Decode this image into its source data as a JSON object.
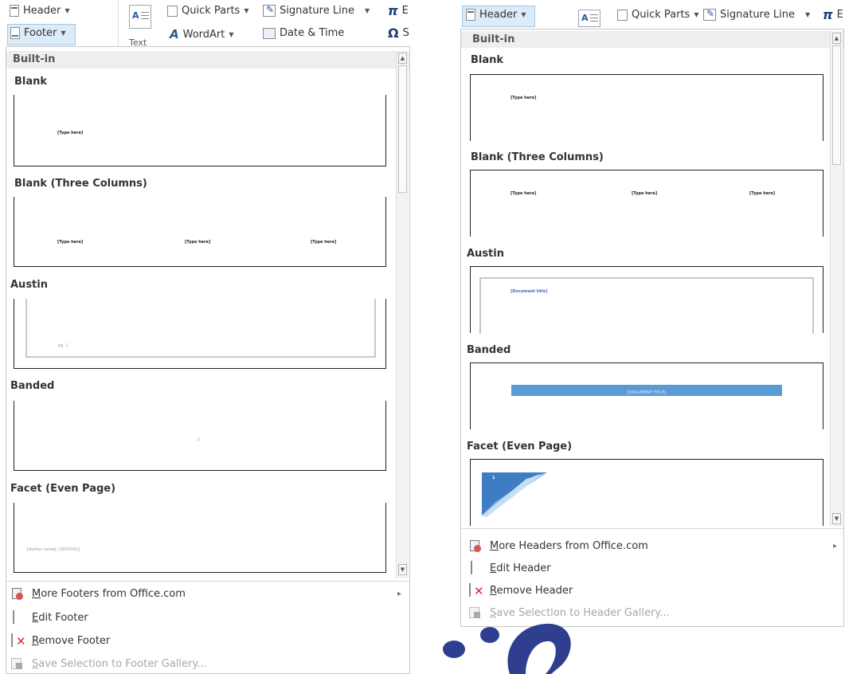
{
  "left": {
    "ribbon": {
      "header": "Header",
      "footer": "Footer",
      "text": "Text",
      "quick_parts": "Quick Parts",
      "wordart": "WordArt",
      "signature_line": "Signature Line",
      "date_time": "Date & Time",
      "pi": "π",
      "pi_partial": "E",
      "omega": "Ω",
      "omega_partial": "S"
    },
    "section": "Built-in",
    "items": [
      {
        "title": "Blank",
        "texts": [
          "[Type here]"
        ]
      },
      {
        "title": "Blank (Three Columns)",
        "texts": [
          "[Type here]",
          "[Type here]",
          "[Type here]"
        ]
      },
      {
        "title": "Austin",
        "texts": [
          "pg. 1"
        ]
      },
      {
        "title": "Banded",
        "texts": [
          "1"
        ]
      },
      {
        "title": "Facet (Even Page)",
        "texts": [
          "[Author name] | [SCHOOL]"
        ]
      }
    ],
    "menu": [
      {
        "pre": "",
        "key": "M",
        "rest": "ore Footers from Office.com",
        "arrow": "▸"
      },
      {
        "pre": "",
        "key": "E",
        "rest": "dit Footer"
      },
      {
        "pre": "",
        "key": "R",
        "rest": "emove Footer"
      },
      {
        "pre": "",
        "key": "S",
        "rest": "ave Selection to Footer Gallery..."
      }
    ]
  },
  "right": {
    "ribbon": {
      "header": "Header",
      "quick_parts": "Quick Parts",
      "signature_line": "Signature Line",
      "pi": "π",
      "pi_partial": "E"
    },
    "section": "Built-in",
    "items": [
      {
        "title": "Blank",
        "texts": [
          "[Type here]"
        ]
      },
      {
        "title": "Blank (Three Columns)",
        "texts": [
          "[Type here]",
          "[Type here]",
          "[Type here]"
        ]
      },
      {
        "title": "Austin",
        "texts": [
          "[Document title]"
        ]
      },
      {
        "title": "Banded",
        "texts": [
          "[DOCUMENT TITLE]"
        ]
      },
      {
        "title": "Facet (Even Page)",
        "texts": [
          "1"
        ]
      }
    ],
    "menu": [
      {
        "key": "M",
        "rest": "ore Headers from Office.com",
        "arrow": "▸"
      },
      {
        "key": "E",
        "rest": "dit Header"
      },
      {
        "key": "R",
        "rest": "emove Header"
      },
      {
        "key": "S",
        "rest": "ave Selection to Header Gallery..."
      }
    ]
  },
  "colors": {
    "accent_blue": "#5a9bd5",
    "selection": "#dcebf8",
    "section_bg": "#eeeeee"
  }
}
